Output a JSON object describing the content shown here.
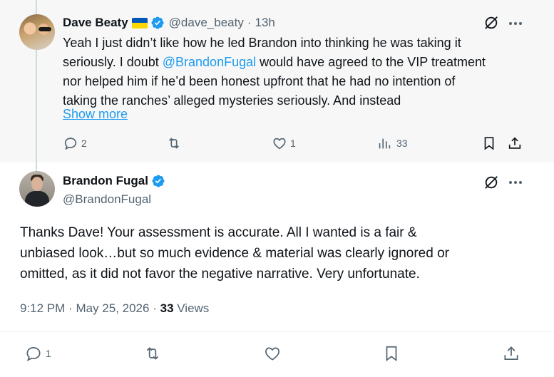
{
  "parent_tweet": {
    "display_name": "Dave Beaty",
    "flag": "ukraine-flag",
    "handle": "@dave_beaty",
    "separator": "·",
    "time_ago": "13h",
    "text_lines": [
      "Yeah I just didn’t like how he led Brandon into thinking he was taking it",
      "seriously.  I doubt ",
      "would have agreed to the VIP treatment",
      "nor helped him if he’d been honest upfront that he had no intention of",
      "taking the ranches’ alleged mysteries seriously.  And instead"
    ],
    "mention": "@BrandonFugal",
    "show_more": "Show more",
    "actions": {
      "replies": "2",
      "reposts": "",
      "likes": "1",
      "views": "33"
    }
  },
  "main_tweet": {
    "display_name": "Brandon Fugal",
    "handle": "@BrandonFugal",
    "text_lines": [
      "Thanks Dave! Your assessment is accurate. All I wanted is a fair &",
      "unbiased look…but so much evidence & material was clearly ignored or",
      "omitted, as it did not favor the negative narrative. Very unfortunate."
    ],
    "time": "9:12 PM",
    "dot": "·",
    "date": "May 25, 2026",
    "dot2": "·",
    "views_count": "33",
    "views_label": "Views",
    "actions": {
      "replies": "1",
      "reposts": "",
      "likes": ""
    }
  },
  "colors": {
    "accent": "#1d9bf0",
    "muted": "#536471",
    "text": "#0f1419",
    "parent_bg": "#f7f7f7"
  }
}
